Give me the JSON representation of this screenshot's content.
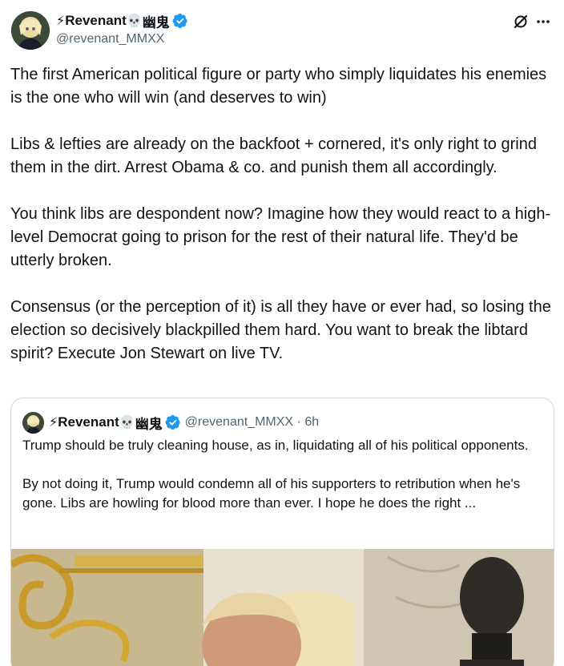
{
  "tweet": {
    "display_name": "Revenant",
    "name_prefix_emoji": "⚡",
    "name_suffix_emoji": "💀",
    "name_suffix_text": "幽鬼",
    "handle": "@revenant_MMXX",
    "paragraphs": [
      "The first American political figure or party who simply liquidates his enemies is the one who will win (and deserves to win)",
      "Libs & lefties are already on the backfoot + cornered, it's only right to grind them in the dirt. Arrest Obama & co. and punish them all accordingly.",
      "You think libs are despondent now? Imagine how they would react to a high-level Democrat going to prison for the rest of their natural life. They'd be utterly broken.",
      "Consensus (or the perception of it) is all they have or ever had, so losing the election so decisively blackpilled them hard. You want to break the libtard spirit? Execute Jon Stewart on live TV."
    ]
  },
  "quote": {
    "display_name": "Revenant",
    "name_prefix_emoji": "⚡",
    "name_suffix_emoji": "💀",
    "name_suffix_text": "幽鬼",
    "handle": "@revenant_MMXX · 6h",
    "paragraphs": [
      "Trump should be truly cleaning house, as in, liquidating all of his political opponents.",
      "By not doing it, Trump would condemn all of his supporters to retribution when he's gone. Libs are howling for blood more than ever. I hope he does the right ..."
    ]
  },
  "icons": {
    "verified": "verified-badge-icon",
    "grok": "grok-icon",
    "more": "more-options-icon"
  },
  "colors": {
    "text": "#0f1419",
    "secondary": "#536471",
    "verified": "#1d9bf0",
    "border": "#cfd9de"
  }
}
